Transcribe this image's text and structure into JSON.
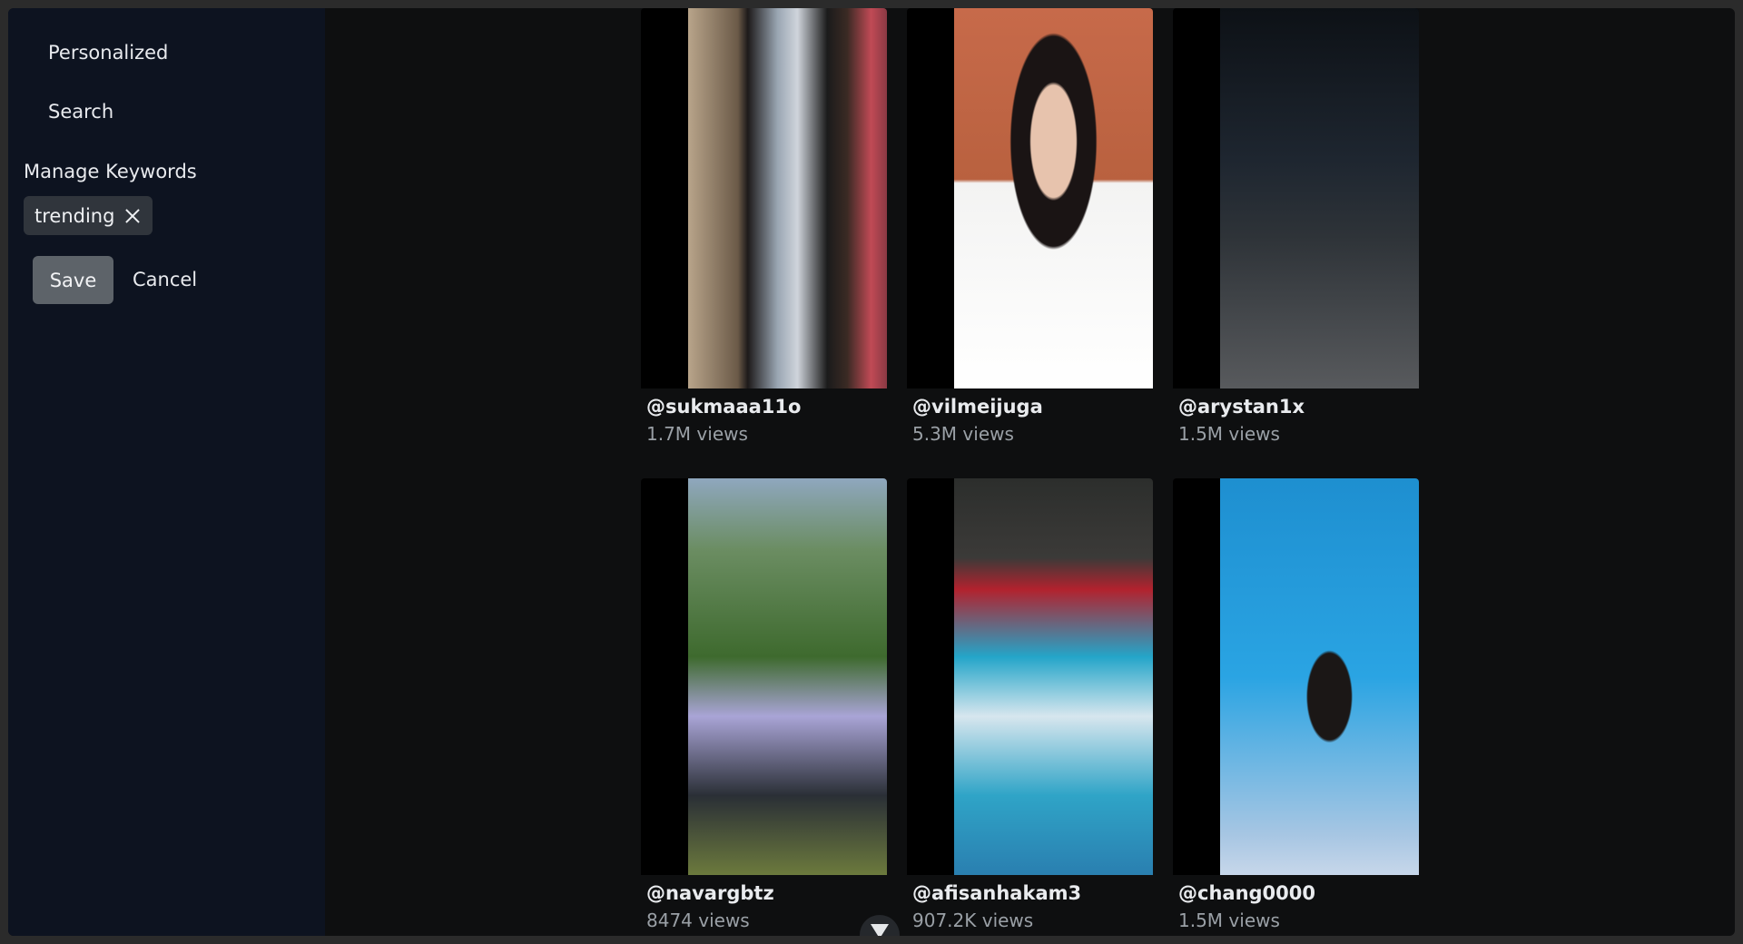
{
  "sidebar": {
    "nav": {
      "personalized": "Personalized",
      "search": "Search"
    },
    "keywords_title": "Manage Keywords",
    "keywords": [
      "trending"
    ],
    "save_label": "Save",
    "cancel_label": "Cancel"
  },
  "feed": {
    "cards": [
      {
        "user": "@sukmaaa11o",
        "views": "1.7M views"
      },
      {
        "user": "@vilmeijuga",
        "views": "5.3M views"
      },
      {
        "user": "@arystan1x",
        "views": "1.5M views"
      },
      {
        "user": "@navargbtz",
        "views": "8474 views"
      },
      {
        "user": "@afisanhakam3",
        "views": "907.2K views"
      },
      {
        "user": "@chang0000",
        "views": "1.5M views"
      }
    ]
  },
  "icons": {
    "chip_close": "close-icon",
    "scroll": "chevron-down-icon"
  }
}
